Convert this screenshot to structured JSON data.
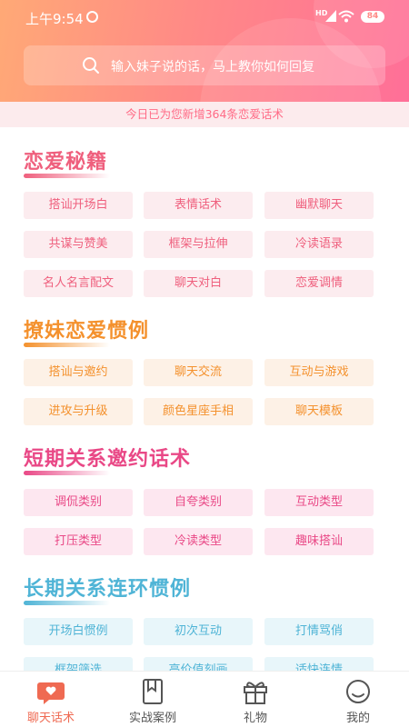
{
  "status": {
    "time": "上午9:54",
    "hd": "HD",
    "battery": "84"
  },
  "search": {
    "placeholder": "输入妹子说的话，马上教你如何回复"
  },
  "notice": "今日已为您新增364条恋爱话术",
  "sections": [
    {
      "title": "恋爱秘籍",
      "tags": [
        "搭讪开场白",
        "表情话术",
        "幽默聊天",
        "共谋与赞美",
        "框架与拉伸",
        "冷读语录",
        "名人名言配文",
        "聊天对白",
        "恋爱调情"
      ]
    },
    {
      "title": "撩妹恋爱惯例",
      "tags": [
        "搭讪与邀约",
        "聊天交流",
        "互动与游戏",
        "进攻与升级",
        "颜色星座手相",
        "聊天模板"
      ]
    },
    {
      "title": "短期关系邀约话术",
      "tags": [
        "调侃类别",
        "自夸类别",
        "互动类型",
        "打压类型",
        "冷读类型",
        "趣味搭讪"
      ]
    },
    {
      "title": "长期关系连环惯例",
      "tags": [
        "开场白惯例",
        "初次互动",
        "打情骂俏",
        "框架筛选",
        "高价值刻画",
        "适快连情"
      ]
    }
  ],
  "colors": {
    "pink": "#ef5f7d",
    "orange": "#f4912d",
    "rose": "#e94886",
    "blue": "#4fb4d6",
    "active_tab": "#ef6a52"
  },
  "tabs": [
    {
      "label": "聊天话术",
      "icon": "chat-bubble-icon",
      "active": true
    },
    {
      "label": "实战案例",
      "icon": "bookmark-icon",
      "active": false
    },
    {
      "label": "礼物",
      "icon": "gift-icon",
      "active": false
    },
    {
      "label": "我的",
      "icon": "smiley-face-icon",
      "active": false
    }
  ]
}
